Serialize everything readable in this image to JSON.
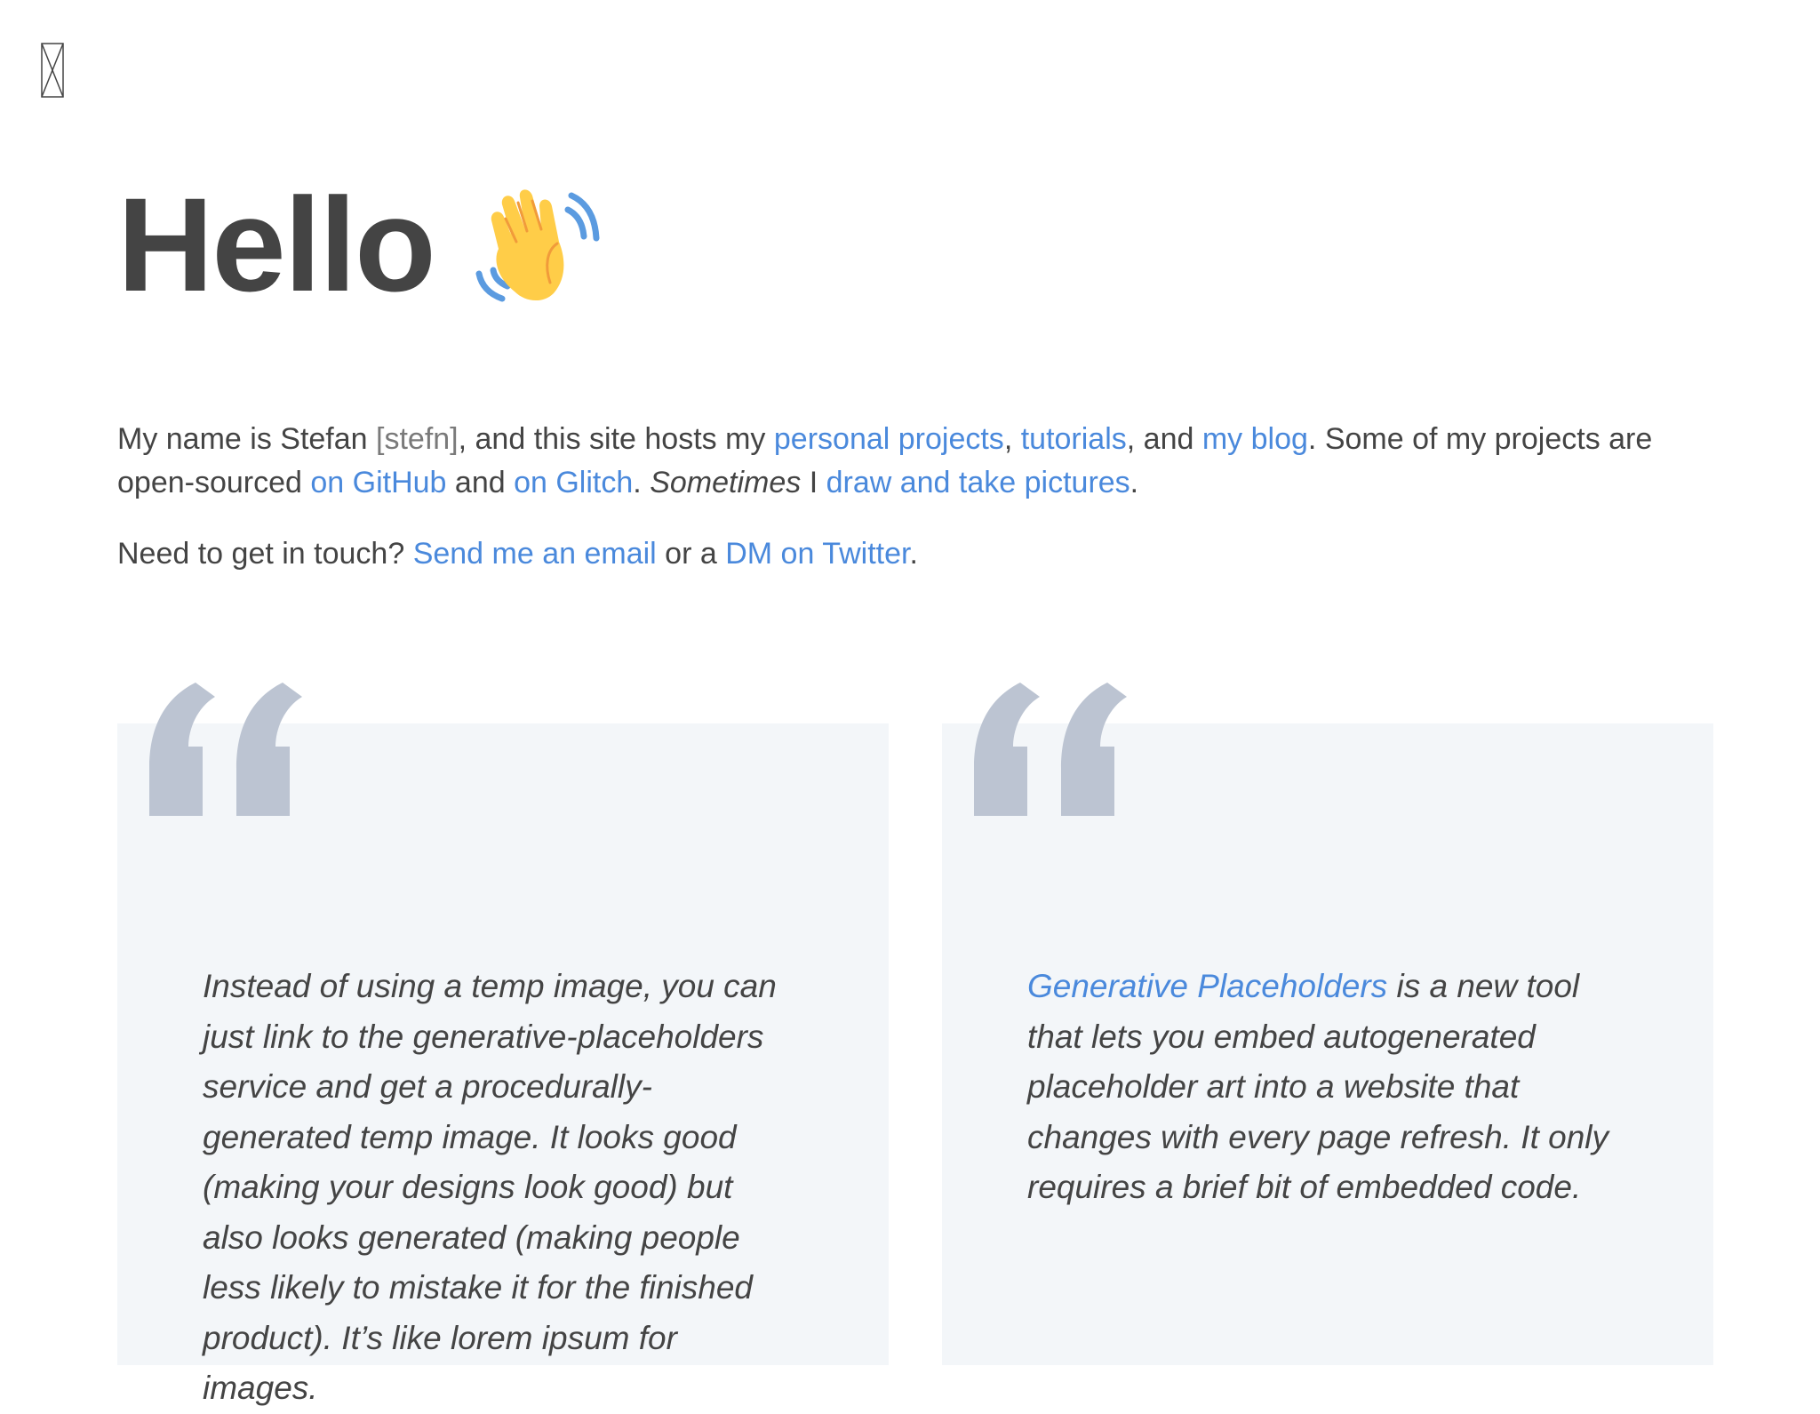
{
  "colors": {
    "text": "#444444",
    "link": "#4a89dc",
    "muted": "#7a7a7a",
    "card_bg": "#f3f6f9",
    "quote_mark": "#bcc4d2"
  },
  "header": {
    "broken_image_icon": "broken-image-icon"
  },
  "hero": {
    "title": "Hello",
    "emoji_icon": "waving-hand-icon"
  },
  "intro": {
    "p1": {
      "t1": "My name is Stefan ",
      "pronunciation": "[stefn]",
      "t2": ", and this site hosts my ",
      "link_projects": "personal projects",
      "t3": ", ",
      "link_tutorials": "tutorials",
      "t4": ", and ",
      "link_blog": "my blog",
      "t5": ". Some of my projects are open-sourced ",
      "link_github": "on GitHub",
      "t6": " and ",
      "link_glitch": "on Glitch",
      "t7": ". ",
      "sometimes": "Sometimes",
      "t8": " I ",
      "link_draw": "draw and take pictures",
      "t9": "."
    },
    "p2": {
      "t1": "Need to get in touch? ",
      "link_email": "Send me an email",
      "t2": " or a ",
      "link_twitter": "DM on Twitter",
      "t3": "."
    }
  },
  "quotes": [
    {
      "text": "Instead of using a temp image, you can just link to the generative-placeholders service and get a procedurally-generated temp image. It looks good (making your designs look good) but also looks generated (making people less likely to mistake it for the finished product). It’s like lorem ipsum for images."
    },
    {
      "link": "Generative Placeholders",
      "text": " is a new tool that lets you embed autogenerated placeholder art into a website that changes with every page refresh. It only requires a brief bit of embedded code."
    }
  ]
}
